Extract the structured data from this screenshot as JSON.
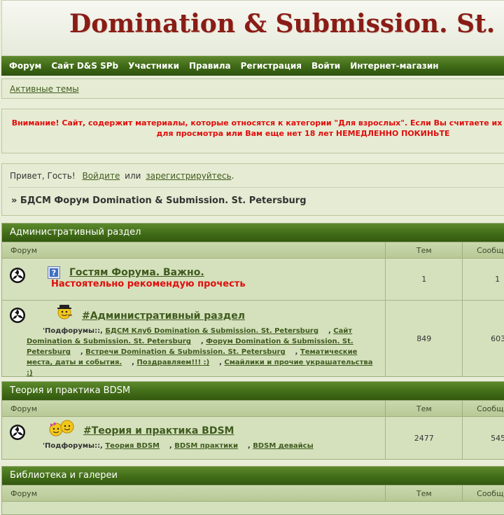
{
  "header": {
    "logo_text": "Domination & Submission. St. Petersburg"
  },
  "nav": {
    "items": [
      {
        "label": "Форум"
      },
      {
        "label": "Сайт D&S SPb"
      },
      {
        "label": "Участники"
      },
      {
        "label": "Правила"
      },
      {
        "label": "Регистрация"
      },
      {
        "label": "Войти"
      },
      {
        "label": "Интернет-магазин"
      }
    ]
  },
  "active_topics": {
    "label": "Активные темы"
  },
  "warning": {
    "line1": "Внимание! Сайт, содержит материалы, которые относятся к категории \"Для взрослых\". Если Вы считаете их",
    "line2": "для просмотра или Вам еще нет 18 лет НЕМЕДЛЕННО ПОКИНЬТЕ"
  },
  "greeting": {
    "prefix": "Привет, Гость!",
    "login": "Войдите",
    "or": "или",
    "register": "зарегистрируйтесь",
    "dot": "."
  },
  "breadcrumb": "» БДСМ Форум Domination & Submission. St. Petersburg",
  "columns": {
    "forum": "Форум",
    "topics": "Тем",
    "posts": "Сообщ"
  },
  "categories": [
    {
      "title": "Административный раздел",
      "forums": [
        {
          "title": "Гостям Форума. Важно.",
          "description": "Настоятельно рекомендую прочесть",
          "topics": "1",
          "posts": "1"
        },
        {
          "title": "#Административный раздел",
          "subforums_label": "'Подфорумы:",
          "subforums": [
            "БДСМ Клуб Domination & Submission. St. Petersburg",
            "Сайт Domination & Submission. St. Petersburg",
            "Форум Domination & Submission. St. Petersburg",
            "Встречи Domination & Submission. St. Petersburg",
            "Тематические места, даты и события.",
            "Поздравляем!!! :)",
            "Смайлики и прочие украшательства :)"
          ],
          "topics": "849",
          "posts": "603"
        }
      ]
    },
    {
      "title": "Теория и практика BDSM",
      "forums": [
        {
          "title": "#Теория и практика BDSM",
          "subforums_label": "'Подфорумы:",
          "subforums": [
            "Теория BDSM",
            "BDSM практики",
            "BDSM девайсы"
          ],
          "topics": "2477",
          "posts": "545"
        }
      ]
    },
    {
      "title": "Библиотека и галереи"
    }
  ],
  "colors": {
    "accent_green": "#3f6a16",
    "warning_red": "#e10d0d",
    "logo_red": "#8a1c16"
  }
}
